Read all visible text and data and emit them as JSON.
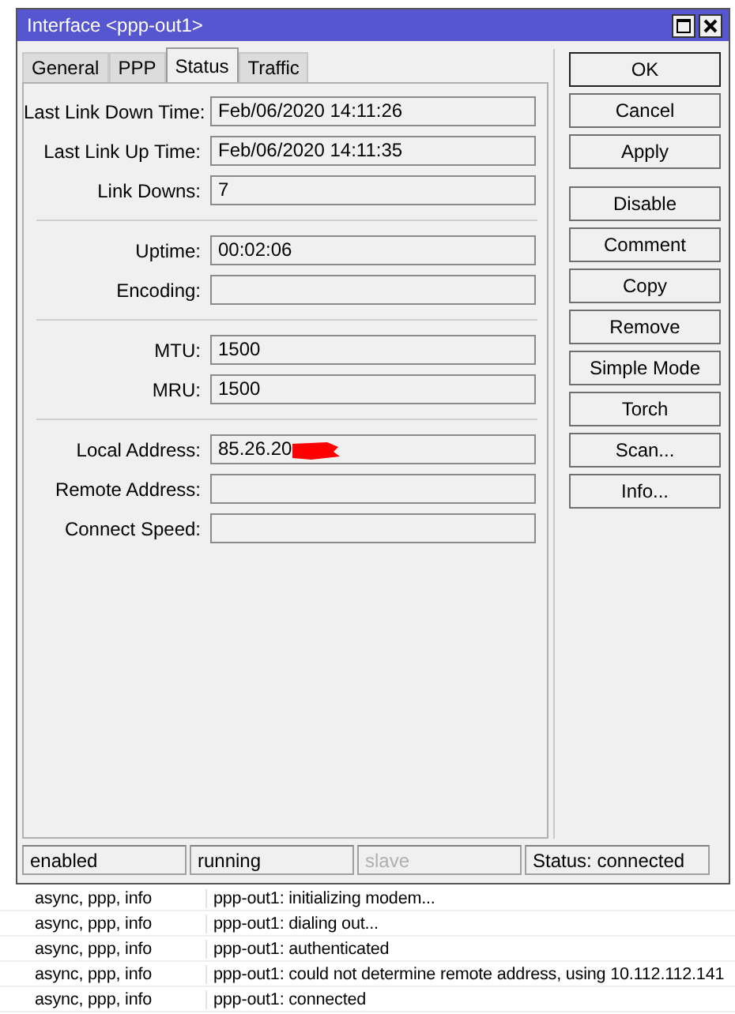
{
  "window": {
    "title": "Interface <ppp-out1>"
  },
  "tabs": [
    {
      "label": "General",
      "selected": false
    },
    {
      "label": "PPP",
      "selected": false
    },
    {
      "label": "Status",
      "selected": true
    },
    {
      "label": "Traffic",
      "selected": false
    }
  ],
  "field_groups": [
    [
      {
        "label": "Last Link Down Time:",
        "value": "Feb/06/2020 14:11:26",
        "redacted": false
      },
      {
        "label": "Last Link Up Time:",
        "value": "Feb/06/2020 14:11:35",
        "redacted": false
      },
      {
        "label": "Link Downs:",
        "value": "7",
        "redacted": false
      }
    ],
    [
      {
        "label": "Uptime:",
        "value": "00:02:06",
        "redacted": false
      },
      {
        "label": "Encoding:",
        "redacted": false
      }
    ],
    [
      {
        "label": "MTU:",
        "value": "1500",
        "redacted": false
      },
      {
        "label": "MRU:",
        "value": "1500",
        "redacted": false
      }
    ],
    [
      {
        "label": "Local Address:",
        "value": "85.26.20",
        "redacted": true
      },
      {
        "label": "Remote Address:",
        "redacted": false
      },
      {
        "label": "Connect Speed:",
        "redacted": false
      }
    ]
  ],
  "button_groups": [
    [
      "OK",
      "Cancel",
      "Apply"
    ],
    [
      "Disable",
      "Comment",
      "Copy",
      "Remove",
      "Simple Mode",
      "Torch",
      "Scan...",
      "Info..."
    ]
  ],
  "status_bar": [
    {
      "text": "enabled",
      "disabled": false
    },
    {
      "text": "running",
      "disabled": false
    },
    {
      "text": "slave",
      "disabled": true
    },
    {
      "text": "Status: connected",
      "disabled": false
    }
  ],
  "log": [
    {
      "topics": "async, ppp, info",
      "message": "ppp-out1: initializing modem..."
    },
    {
      "topics": "async, ppp, info",
      "message": "ppp-out1: dialing out..."
    },
    {
      "topics": "async, ppp, info",
      "message": "ppp-out1: authenticated"
    },
    {
      "topics": "async, ppp, info",
      "message": "ppp-out1: could not determine remote address, using 10.112.112.141"
    },
    {
      "topics": "async, ppp, info",
      "message": "ppp-out1: connected"
    }
  ]
}
